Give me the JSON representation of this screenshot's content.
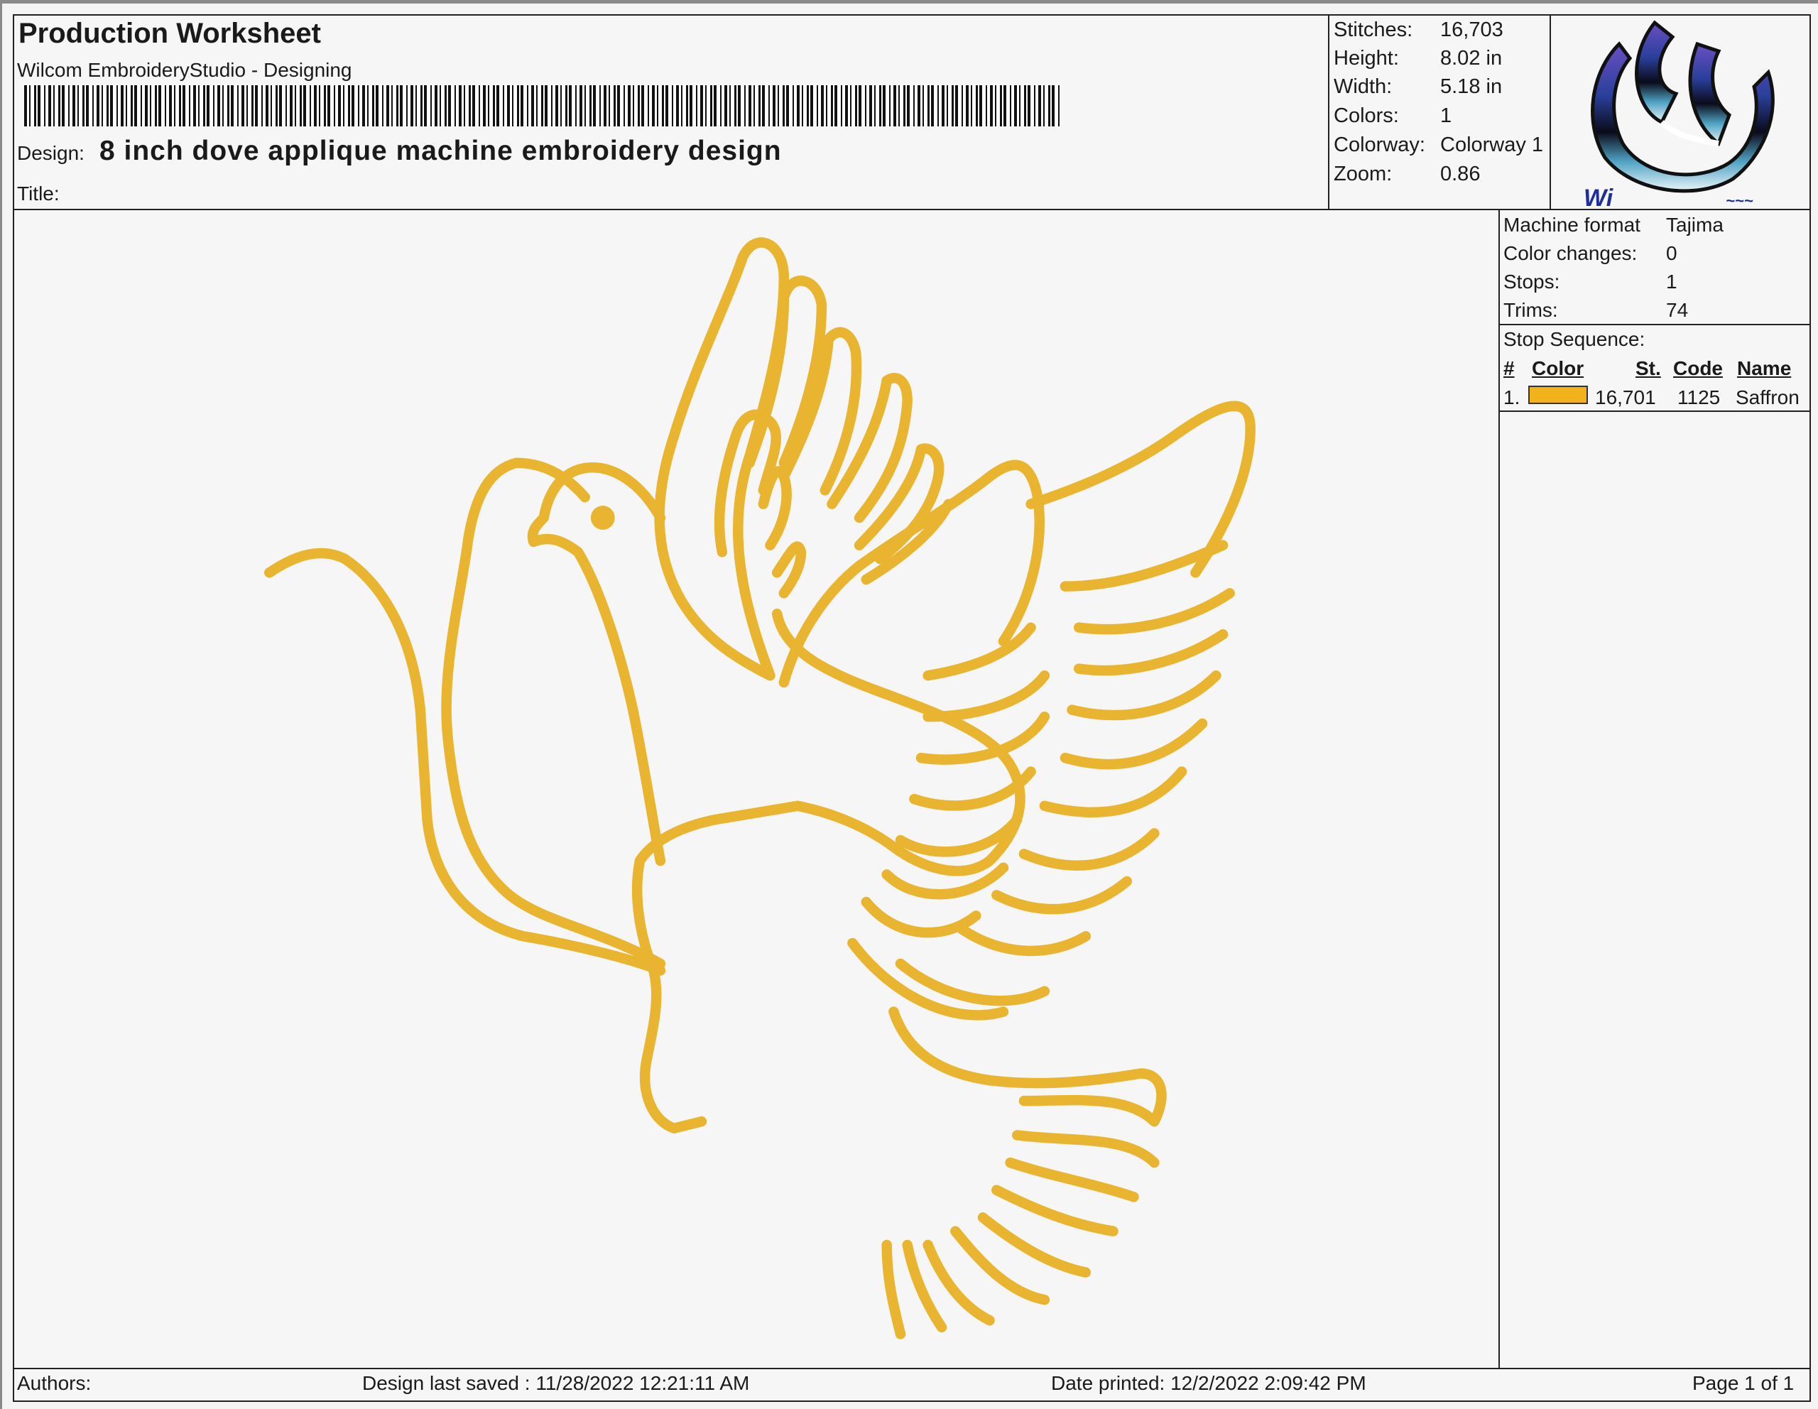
{
  "header": {
    "title": "Production Worksheet",
    "app": "Wilcom EmbroideryStudio - Designing",
    "design_label": "Design:",
    "design_name": "8 inch dove applique machine embroidery design",
    "title_label": "Title:"
  },
  "stats": {
    "stitches_label": "Stitches:",
    "stitches": "16,703",
    "height_label": "Height:",
    "height": "8.02 in",
    "width_label": "Width:",
    "width": "5.18 in",
    "colors_label": "Colors:",
    "colors": "1",
    "colorway_label": "Colorway:",
    "colorway": "Colorway 1",
    "zoom_label": "Zoom:",
    "zoom": "0.86"
  },
  "machine": {
    "format_label": "Machine format",
    "format": "Tajima",
    "color_changes_label": "Color changes:",
    "color_changes": "0",
    "stops_label": "Stops:",
    "stops": "1",
    "trims_label": "Trims:",
    "trims": "74"
  },
  "stop_sequence": {
    "label": "Stop Sequence:",
    "headers": {
      "num": "#",
      "color": "Color",
      "st": "St.",
      "code": "Code",
      "name": "Name"
    },
    "rows": [
      {
        "num": "1.",
        "swatch": "#F2B21C",
        "st": "16,701",
        "code": "1125",
        "name": "Saffron"
      }
    ]
  },
  "logo": {
    "icon": "wilcom-logo-icon"
  },
  "thread_color": "#E9B530",
  "footer": {
    "authors_label": "Authors:",
    "last_saved": "Design last saved : 11/28/2022 12:21:11 AM",
    "date_printed": "Date printed: 12/2/2022 2:09:42 PM",
    "page": "Page 1 of 1"
  }
}
